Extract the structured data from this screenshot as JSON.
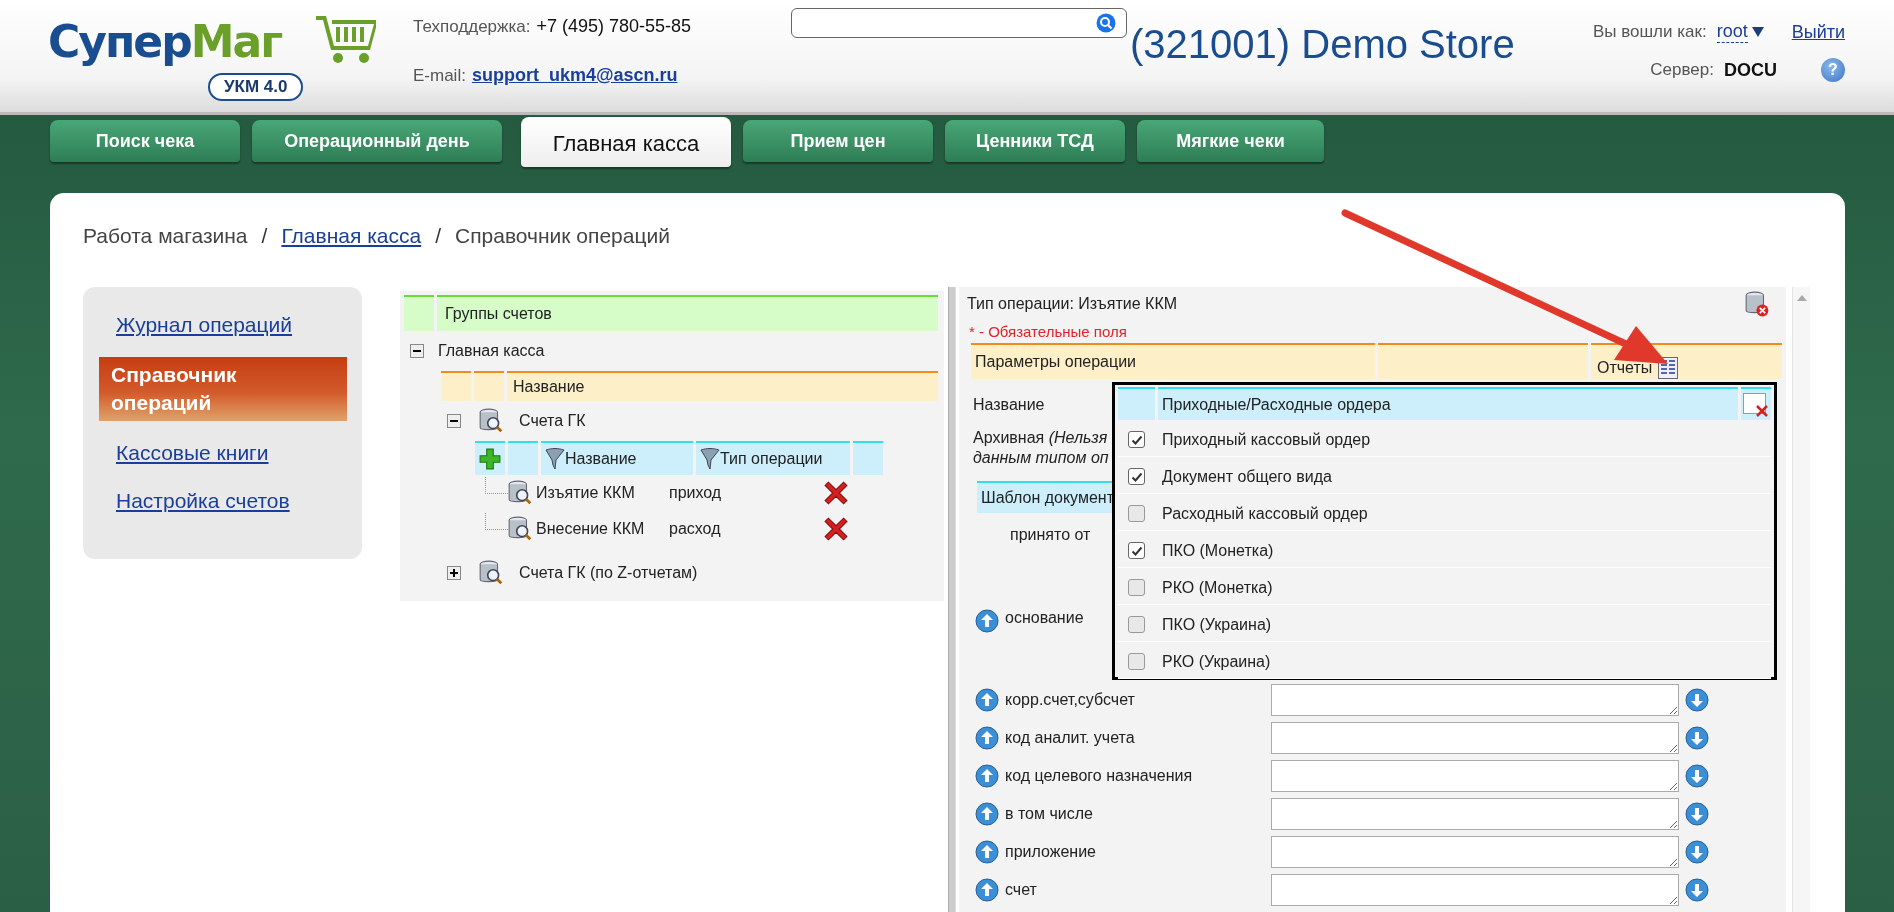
{
  "header": {
    "logo": {
      "text_1": "Супер",
      "text_2": "Маг",
      "badge": "УКМ 4.0"
    },
    "support": {
      "label": "Техподдержка:",
      "phone": "+7 (495) 780-55-85",
      "email_label": "E-mail:",
      "email": "support_ukm4@ascn.ru"
    },
    "store": "(321001) Demo Store",
    "user": {
      "label": "Вы вошли как:",
      "name": "root",
      "logout": "Выйти",
      "server_label": "Сервер:",
      "server": "DOCU",
      "help": "?"
    }
  },
  "tabs": [
    {
      "label": "Поиск чека",
      "selected": false
    },
    {
      "label": "Операционный день",
      "selected": false
    },
    {
      "label": "Главная касса",
      "selected": true
    },
    {
      "label": "Прием цен",
      "selected": false
    },
    {
      "label": "Ценники ТСД",
      "selected": false
    },
    {
      "label": "Мягкие чеки",
      "selected": false
    }
  ],
  "breadcrumb": {
    "items": [
      {
        "label": "Работа магазина",
        "link": false
      },
      {
        "label": "Главная касса",
        "link": true
      },
      {
        "label": "Справочник операций",
        "link": false
      }
    ],
    "separators": [
      "/",
      "/"
    ]
  },
  "sidebar": {
    "items": [
      {
        "label": "Журнал операций",
        "selected": false
      },
      {
        "label": "Справочник операций",
        "selected": true
      },
      {
        "label": "Кассовые книги",
        "selected": false
      },
      {
        "label": "Настройка счетов",
        "selected": false
      }
    ]
  },
  "tree": {
    "header": "Группы счетов",
    "root": {
      "label": "Главная касса",
      "expanded": true,
      "column": "Название",
      "children": [
        {
          "label": "Счета ГК",
          "expanded": true,
          "columns": [
            "Название",
            "Тип операции"
          ],
          "operations": [
            {
              "name": "Изъятие ККМ",
              "type": "приход"
            },
            {
              "name": "Внесение ККМ",
              "type": "расход"
            }
          ]
        },
        {
          "label": "Счета ГК (по Z-отчетам)",
          "expanded": false
        }
      ]
    }
  },
  "operation": {
    "title": "Тип операции: Изъятие ККМ",
    "required_note": "* - Обязательные поля",
    "params_header": "Параметры операции",
    "reports_label": "Отчеты",
    "fields": [
      {
        "kind": "plain",
        "label": "Название"
      },
      {
        "kind": "archive",
        "label": "Архивная *(Нельзя*",
        "line_2": "*данным типом оп*"
      },
      {
        "kind": "section",
        "label": "Шаблон документ"
      },
      {
        "kind": "indent",
        "label": "принято от"
      },
      {
        "kind": "movable",
        "label": "основание"
      },
      {
        "kind": "movable_field",
        "label": "корр.счет,субсчет"
      },
      {
        "kind": "movable_field",
        "label": "код аналит. учета"
      },
      {
        "kind": "movable_field",
        "label": "код целевого назначения"
      },
      {
        "kind": "movable_field",
        "label": "в том числе"
      },
      {
        "kind": "movable_field",
        "label": "приложение"
      },
      {
        "kind": "movable_field",
        "label": "счет"
      }
    ]
  },
  "reports": {
    "title": "Приходные/Расходные ордера",
    "items": [
      {
        "label": "Приходный кассовый ордер",
        "checked": true
      },
      {
        "label": "Документ общего вида",
        "checked": true
      },
      {
        "label": "Расходный кассовый ордер",
        "checked": false
      },
      {
        "label": "ПКО (Монетка)",
        "checked": true
      },
      {
        "label": "РКО (Монетка)",
        "checked": false
      },
      {
        "label": "ПКО (Украина)",
        "checked": false
      },
      {
        "label": "РКО (Украина)",
        "checked": false
      }
    ]
  }
}
